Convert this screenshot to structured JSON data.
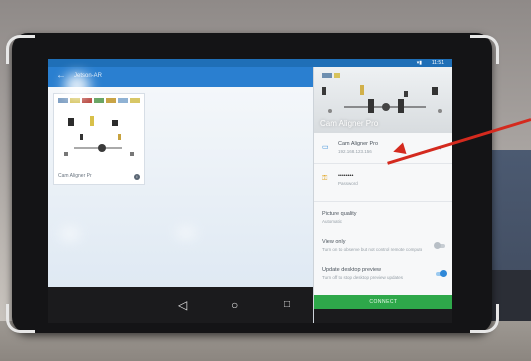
{
  "screen": {
    "status_time": "11:51",
    "app_title": "Jetson-AR",
    "thumbnail_caption": "Cam Aligner Pr",
    "info_glyph": "i"
  },
  "panel": {
    "hero_title": "Cam Aligner Pro",
    "device_name": "Cam Aligner Pro",
    "device_address": "192.168.123.156",
    "password_mask": "••••••••",
    "password_label": "Password",
    "picture_quality_label": "Picture quality",
    "picture_quality_value": "Automatic",
    "view_only_label": "View only",
    "view_only_desc": "Turn on to observe but not control remote computer",
    "view_only_on": false,
    "update_preview_label": "Update desktop preview",
    "update_preview_desc": "Turn off to stop desktop preview updates",
    "update_preview_on": true,
    "connect_label": "CONNECT"
  },
  "colors": {
    "app_bar": "#2a7fd0",
    "accent": "#2f88d8",
    "connect": "#2ea84a",
    "annotation_arrow": "#d42a1e"
  },
  "icons": {
    "device": "monitor-icon",
    "password": "key-icon",
    "selected": "check-icon",
    "nav_back": "triangle-back-icon",
    "nav_home": "circle-home-icon",
    "nav_recents": "square-recents-icon"
  }
}
